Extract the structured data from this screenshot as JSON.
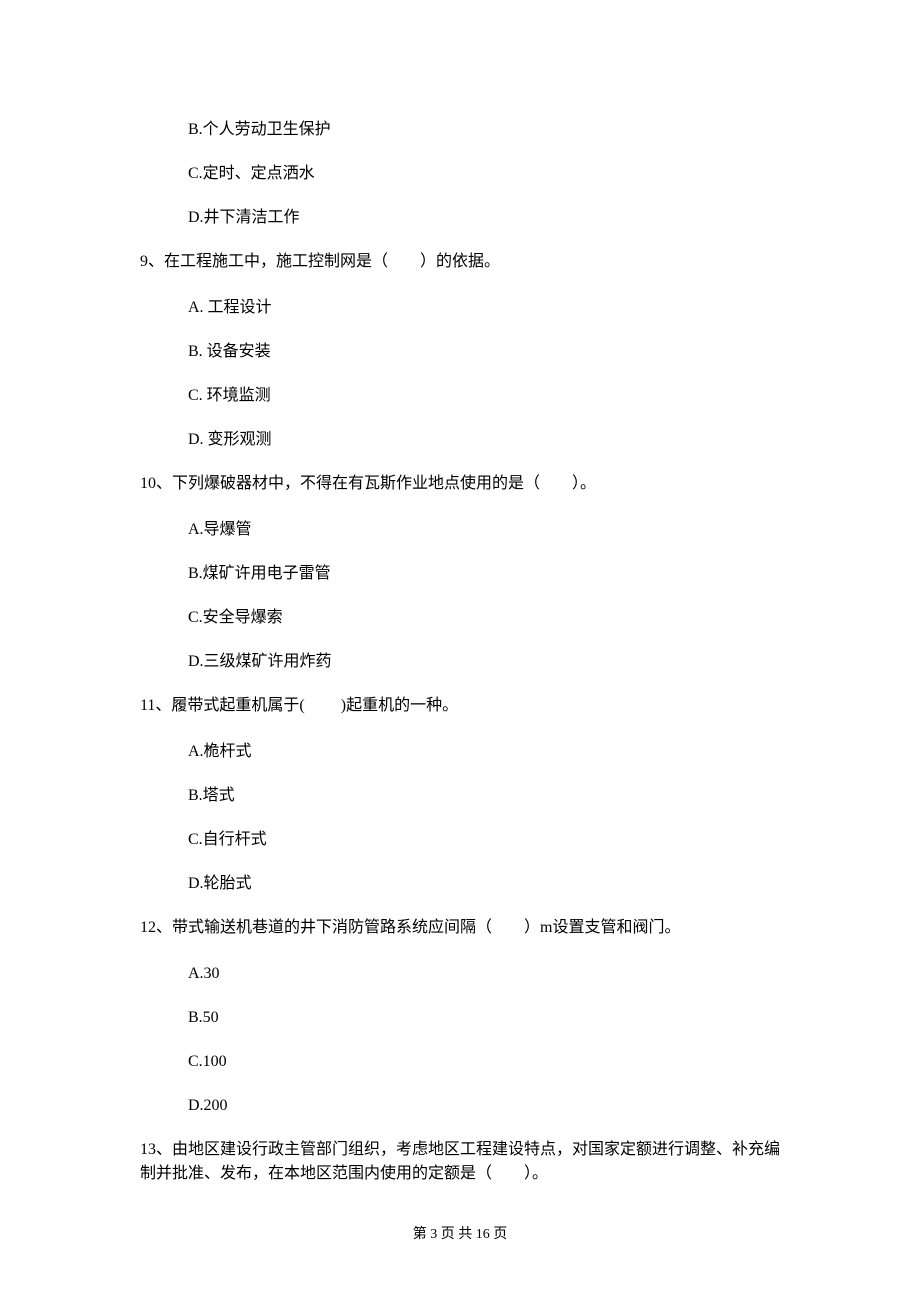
{
  "q8_options": {
    "b": "B.个人劳动卫生保护",
    "c": "C.定时、定点洒水",
    "d": "D.井下清洁工作"
  },
  "q9": {
    "text": "9、在工程施工中，施工控制网是（　　）的依据。",
    "a": "A.  工程设计",
    "b": "B.  设备安装",
    "c": "C.  环境监测",
    "d": "D.  变形观测"
  },
  "q10": {
    "text": "10、下列爆破器材中，不得在有瓦斯作业地点使用的是（　　）。",
    "a": "A.导爆管",
    "b": "B.煤矿许用电子雷管",
    "c": "C.安全导爆索",
    "d": "D.三级煤矿许用炸药"
  },
  "q11": {
    "text": "11、履带式起重机属于(　　 )起重机的一种。",
    "a": "A.桅杆式",
    "b": "B.塔式",
    "c": "C.自行杆式",
    "d": "D.轮胎式"
  },
  "q12": {
    "text": "12、带式输送机巷道的井下消防管路系统应间隔（　　）m设置支管和阀门。",
    "a": "A.30",
    "b": "B.50",
    "c": "C.100",
    "d": "D.200"
  },
  "q13": {
    "text": "13、由地区建设行政主管部门组织，考虑地区工程建设特点，对国家定额进行调整、补充编制并批准、发布，在本地区范围内使用的定额是（　　）。"
  },
  "footer": "第 3 页 共 16 页"
}
